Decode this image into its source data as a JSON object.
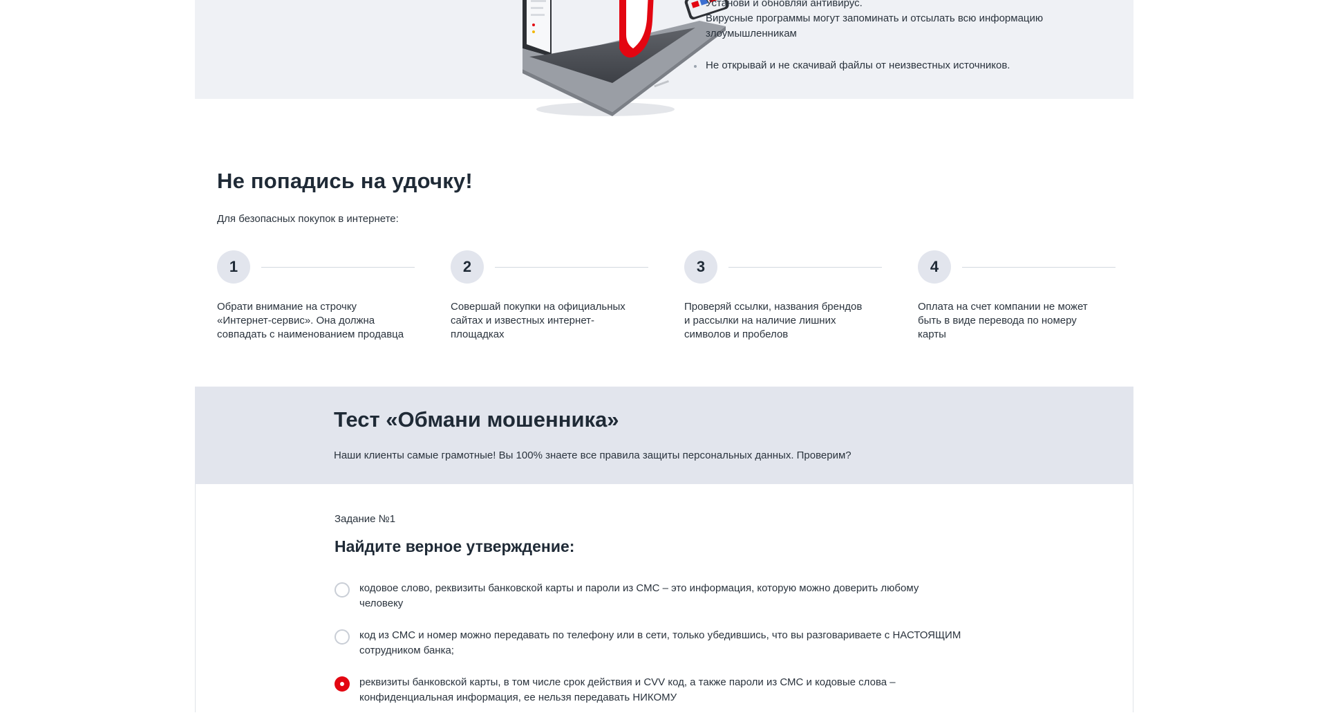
{
  "top_tips": [
    {
      "lines": [
        "Установи и обновляй антивирус.",
        "Вирусные программы могут запоминать и отсылать всю информацию",
        "злоумышленникам"
      ]
    },
    {
      "lines": [
        "Не открывай и не скачивай файлы от неизвестных источников."
      ]
    }
  ],
  "phishing": {
    "title": "Не попадись на удочку!",
    "lead": "Для безопасных покупок в интернете:",
    "steps": [
      {
        "num": "1",
        "lines": [
          "Обрати внимание на строчку",
          "«Интернет-сервис». Она должна",
          "совпадать с наименованием продавца"
        ]
      },
      {
        "num": "2",
        "lines": [
          "Совершай покупки на официальных",
          "сайтах и известных интернет-",
          "площадках"
        ]
      },
      {
        "num": "3",
        "lines": [
          "Проверяй ссылки, названия брендов",
          "и рассылки на наличие лишних",
          "символов и пробелов"
        ]
      },
      {
        "num": "4",
        "lines": [
          "Оплата на счет компании не может",
          "быть в виде перевода по номеру",
          "карты"
        ]
      }
    ]
  },
  "test": {
    "title": "Тест «Обмани мошенника»",
    "subtitle": "Наши клиенты самые грамотные! Вы 100% знаете все правила защиты персональных данных. Проверим?",
    "task_label": "Задание №1",
    "question": "Найдите верное утверждение:",
    "options": [
      {
        "lines": [
          "кодовое слово, реквизиты банковской карты и пароли из СМС – это информация, которую можно доверить любому",
          "человеку"
        ],
        "selected": false
      },
      {
        "lines": [
          "код из СМС и номер можно передавать по телефону или в сети, только убедившись, что вы разговариваете с НАСТОЯЩИМ",
          "сотрудником банка;"
        ],
        "selected": false
      },
      {
        "lines": [
          "реквизиты банковской карты, в том числе срок действия и CVV код, а также пароли из СМС и кодовые слова –",
          "конфиденциальная информация, ее нельзя передавать НИКОМУ"
        ],
        "selected": true
      }
    ]
  },
  "colors": {
    "accent": "#e30611",
    "band": "#eff1f5",
    "test_band": "#e2e5ed"
  }
}
